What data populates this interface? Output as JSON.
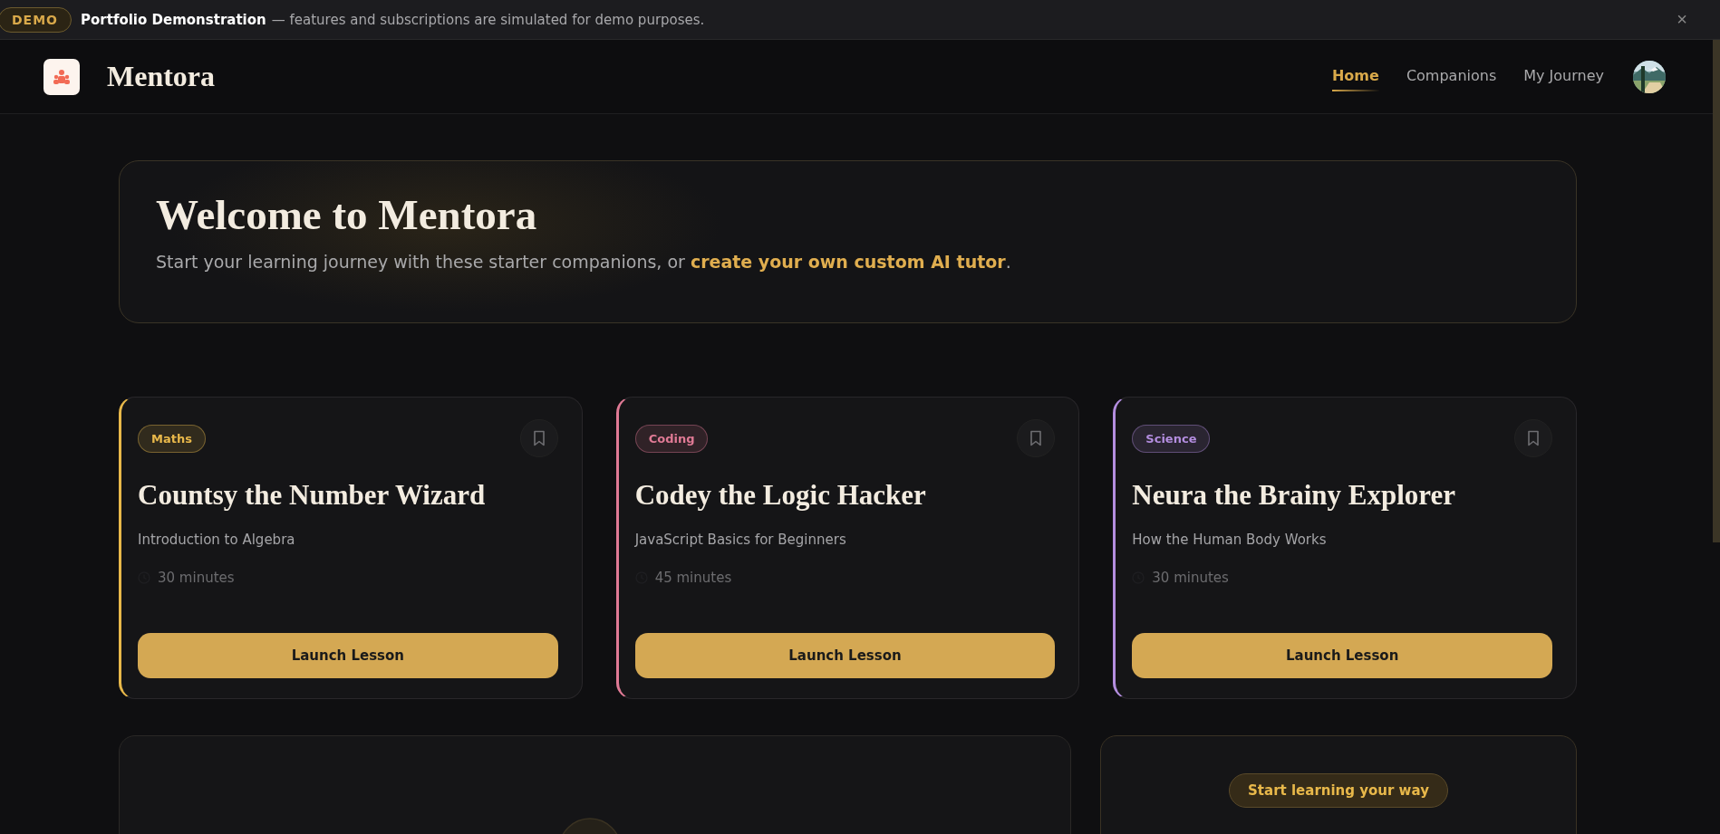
{
  "banner": {
    "badge": "DEMO",
    "title": "Portfolio Demonstration",
    "text": "— features and subscriptions are simulated for demo purposes.",
    "close": "×"
  },
  "nav": {
    "brand": "Mentora",
    "links": [
      {
        "label": "Home",
        "selected": true
      },
      {
        "label": "Companions",
        "selected": false
      },
      {
        "label": "My Journey",
        "selected": false
      }
    ]
  },
  "hero": {
    "title": "Welcome to Mentora",
    "text": "Start your learning journey with these starter companions, or **create your own custom AI tutor**."
  },
  "cards": [
    {
      "subject": "Maths",
      "color": "#e8b84a",
      "name": "Countsy the Number Wizard",
      "topic": "Introduction to Algebra",
      "duration": "30 minutes",
      "button": "Launch Lesson"
    },
    {
      "subject": "Coding",
      "color": "#e07a95",
      "name": "Codey the Logic Hacker",
      "topic": "JavaScript Basics for Beginners",
      "duration": "45 minutes",
      "button": "Launch Lesson"
    },
    {
      "subject": "Science",
      "color": "#b48ee0",
      "name": "Neura the Brainy Explorer",
      "topic": "How the Human Body Works",
      "duration": "30 minutes",
      "button": "Launch Lesson"
    }
  ],
  "promo": {
    "badge": "Start learning your way"
  }
}
